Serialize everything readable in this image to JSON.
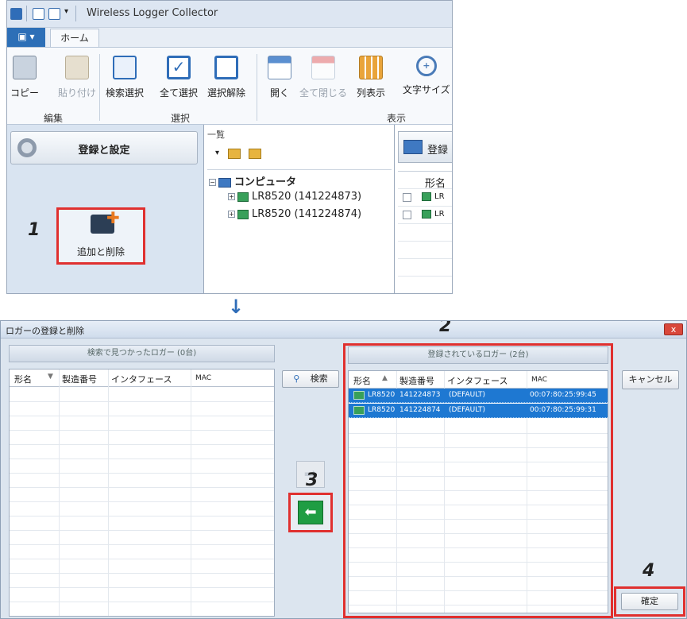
{
  "app": {
    "title": "Wireless Logger Collector",
    "tabs": {
      "file_icon": "app-menu-icon",
      "home": "ホーム"
    },
    "ribbon": {
      "copy": "コピー",
      "paste": "貼り付け",
      "search_select": "検索選択",
      "select_all": "全て選択",
      "deselect": "選択解除",
      "open": "開く",
      "close_all": "全て閉じる",
      "column_view": "列表示",
      "font_size": "文字サイズ",
      "group_edit": "編集",
      "group_select": "選択",
      "group_view": "表示"
    },
    "left": {
      "register_settings": "登録と設定",
      "add_remove": "追加と削除",
      "step": "1"
    },
    "list": {
      "title": "一覧",
      "computer": "コンピュータ",
      "loggers": [
        "LR8520 (141224873)",
        "LR8520 (141224874)"
      ]
    },
    "right": {
      "header": "登録",
      "col_model": "形名",
      "rows": [
        "LR",
        "LR"
      ]
    }
  },
  "dialog": {
    "title": "ロガーの登録と削除",
    "close": "x",
    "found_header": "検索で見つかったロガー (0台)",
    "registered_header": "登録されているロガー (2台)",
    "columns": {
      "model": "形名",
      "serial": "製造番号",
      "interface": "インタフェース",
      "mac": "MAC"
    },
    "search_button": "検索",
    "cancel_button": "キャンセル",
    "ok_button": "確定",
    "registered_rows": [
      {
        "model": "LR8520",
        "serial": "141224873",
        "interface": "(DEFAULT)",
        "mac": "00:07:80:25:99:45"
      },
      {
        "model": "LR8520",
        "serial": "141224874",
        "interface": "(DEFAULT)",
        "mac": "00:07:80:25:99:31"
      }
    ],
    "steps": {
      "two": "2",
      "three": "3",
      "four": "4"
    }
  },
  "colors": {
    "highlight": "#e0302f",
    "selection": "#1e78d2",
    "accent": "#2f6db8"
  }
}
